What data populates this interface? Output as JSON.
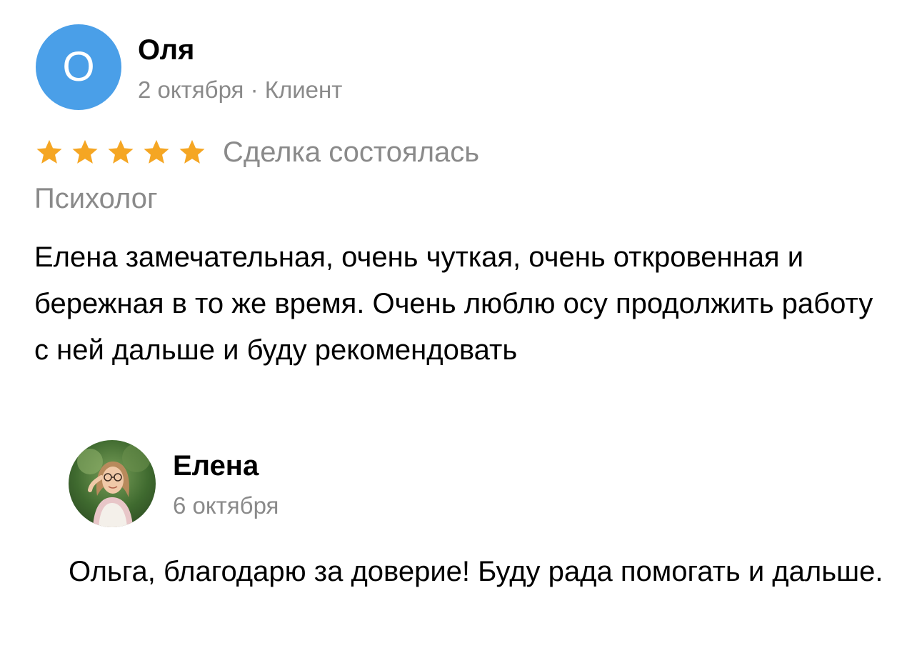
{
  "review": {
    "author_initial": "О",
    "author_name": "Оля",
    "meta": "2 октября · Клиент",
    "rating": 5,
    "rating_max": 5,
    "star_color": "#f5a623",
    "avatar_color": "#4a9fe8",
    "deal_status": "Сделка состоялась",
    "category": "Психолог",
    "text": "Елена замечательная, очень чуткая, очень откровенная и бережная в то же время. Очень люблю осу продолжить работу с ней дальше и буду рекомендовать"
  },
  "reply": {
    "author_name": "Елена",
    "date": "6 октября",
    "text": "Ольга, благодарю за доверие! Буду рада помогать и дальше."
  }
}
